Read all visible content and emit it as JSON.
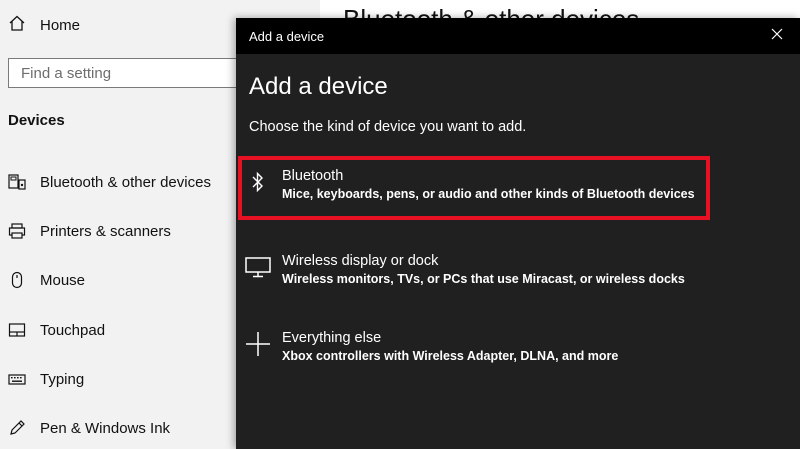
{
  "sidebar": {
    "home_label": "Home",
    "search_placeholder": "Find a setting",
    "section_title": "Devices",
    "items": [
      {
        "label": "Bluetooth & other devices",
        "icon": "bluetooth-devices-icon"
      },
      {
        "label": "Printers & scanners",
        "icon": "printer-icon"
      },
      {
        "label": "Mouse",
        "icon": "mouse-icon"
      },
      {
        "label": "Touchpad",
        "icon": "touchpad-icon"
      },
      {
        "label": "Typing",
        "icon": "keyboard-icon"
      },
      {
        "label": "Pen & Windows Ink",
        "icon": "pen-icon"
      }
    ]
  },
  "background": {
    "page_title": "Bluetooth & other devices"
  },
  "dialog": {
    "window_title": "Add a device",
    "heading": "Add a device",
    "subtitle": "Choose the kind of device you want to add.",
    "options": [
      {
        "title": "Bluetooth",
        "description": "Mice, keyboards, pens, or audio and other kinds of Bluetooth devices",
        "icon": "bluetooth-icon",
        "highlighted": true
      },
      {
        "title": "Wireless display or dock",
        "description": "Wireless monitors, TVs, or PCs that use Miracast, or wireless docks",
        "icon": "monitor-icon",
        "highlighted": false
      },
      {
        "title": "Everything else",
        "description": "Xbox controllers with Wireless Adapter, DLNA, and more",
        "icon": "plus-icon",
        "highlighted": false
      }
    ]
  },
  "colors": {
    "dialog_bg": "#202020",
    "titlebar_bg": "#000000",
    "sidebar_bg": "#f2f2f2",
    "highlight_border": "#e81123"
  }
}
